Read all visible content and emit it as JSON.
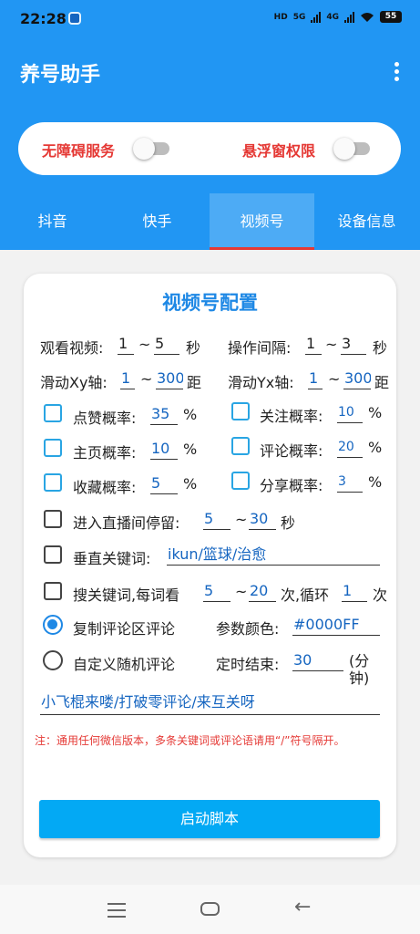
{
  "status": {
    "time": "22:28",
    "net_hd": "HD",
    "net_5g": "5G",
    "net_4g": "4G",
    "battery": "55"
  },
  "app": {
    "title": "养号助手"
  },
  "permissions": {
    "accessibility": "无障碍服务",
    "overlay": "悬浮窗权限"
  },
  "tabs": [
    "抖音",
    "快手",
    "视频号",
    "设备信息"
  ],
  "config": {
    "title": "视频号配置",
    "watch_label": "观看视频:",
    "watch_min": "1",
    "watch_max": "5",
    "sec": "秒",
    "interval_label": "操作间隔:",
    "interval_min": "1",
    "interval_max": "3",
    "interval_unit": "秒",
    "swipe_xy_label": "滑动Xy轴:",
    "swipe_xy_min": "1",
    "swipe_xy_max": "300",
    "swipe_xy_unit": "距",
    "swipe_yx_label": "滑动Yx轴:",
    "swipe_yx_min": "1",
    "swipe_yx_max": "300",
    "swipe_yx_unit": "距",
    "tilde": "~",
    "percent": "%",
    "like_label": "点赞概率:",
    "like_val": "35",
    "follow_label": "关注概率:",
    "follow_val": "10",
    "home_label": "主页概率:",
    "home_val": "10",
    "comment_label": "评论概率:",
    "comment_val": "20",
    "fav_label": "收藏概率:",
    "fav_val": "5",
    "share_label": "分享概率:",
    "share_val": "3",
    "live_label": "进入直播间停留:",
    "live_min": "5",
    "live_max": "30",
    "live_unit": "秒",
    "keyword_label": "垂直关键词:",
    "keyword_val": "ikun/篮球/治愈",
    "search_label": "搜关键词,每词看",
    "search_min": "5",
    "search_max": "20",
    "search_mid": "次,循环",
    "search_loop": "1",
    "search_unit": "次",
    "copy_comment": "复制评论区评论",
    "param_color_label": "参数颜色:",
    "param_color": "#0000FF",
    "custom_comment": "自定义随机评论",
    "timer_label": "定时结束:",
    "timer_val": "30",
    "timer_unit": "(分钟)",
    "comments_val": "小飞棍来喽/打破零评论/来互关呀",
    "note": "注：通用任何微信版本，多条关键词或评论语请用“/”符号隔开。",
    "start": "启动脚本"
  },
  "colors": {
    "primary": "#2196F3",
    "accent": "#03a9f4",
    "warning": "#e53935"
  }
}
